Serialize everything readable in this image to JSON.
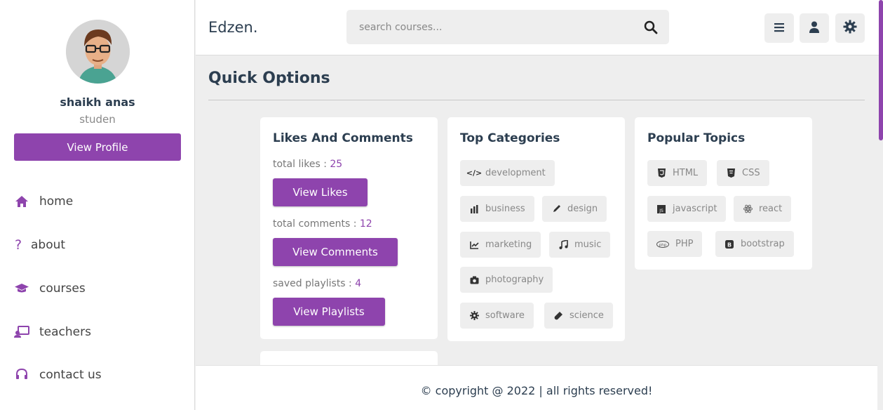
{
  "sidebar": {
    "user_name": "shaikh anas",
    "user_role": "studen",
    "profile_button": "View Profile",
    "nav": [
      {
        "label": "home",
        "icon": "home-icon"
      },
      {
        "label": "about",
        "icon": "question-icon"
      },
      {
        "label": "courses",
        "icon": "graduation-cap-icon"
      },
      {
        "label": "teachers",
        "icon": "teacher-icon"
      },
      {
        "label": "contact us",
        "icon": "headset-icon"
      }
    ]
  },
  "header": {
    "logo": "Edzen.",
    "search_placeholder": "search courses...",
    "buttons": [
      "menu-icon",
      "user-icon",
      "settings-icon"
    ]
  },
  "main": {
    "heading": "Quick Options",
    "likes_card": {
      "title": "Likes And Comments",
      "likes_label": "total likes : ",
      "likes_value": "25",
      "likes_button": "View Likes",
      "comments_label": "total comments : ",
      "comments_value": "12",
      "comments_button": "View Comments",
      "playlists_label": "saved playlists : ",
      "playlists_value": "4",
      "playlists_button": "View Playlists"
    },
    "categories_card": {
      "title": "Top Categories",
      "tags": [
        {
          "label": "development",
          "icon": "code-icon"
        },
        {
          "label": "business",
          "icon": "bar-chart-icon"
        },
        {
          "label": "design",
          "icon": "pen-icon"
        },
        {
          "label": "marketing",
          "icon": "line-chart-icon"
        },
        {
          "label": "music",
          "icon": "music-icon"
        },
        {
          "label": "photography",
          "icon": "camera-icon"
        },
        {
          "label": "software",
          "icon": "gear-icon"
        },
        {
          "label": "science",
          "icon": "vial-icon"
        }
      ]
    },
    "topics_card": {
      "title": "Popular Topics",
      "tags": [
        {
          "label": "HTML",
          "icon": "html5-icon"
        },
        {
          "label": "CSS",
          "icon": "css3-icon"
        },
        {
          "label": "javascript",
          "icon": "js-icon"
        },
        {
          "label": "react",
          "icon": "react-icon"
        },
        {
          "label": "PHP",
          "icon": "php-icon"
        },
        {
          "label": "bootstrap",
          "icon": "bootstrap-icon"
        }
      ]
    }
  },
  "footer": {
    "text": "© copyright @ 2022 | all rights reserved!"
  },
  "colors": {
    "accent": "#8e44ad",
    "background": "#eeeeee",
    "text": "#2c3e50"
  }
}
